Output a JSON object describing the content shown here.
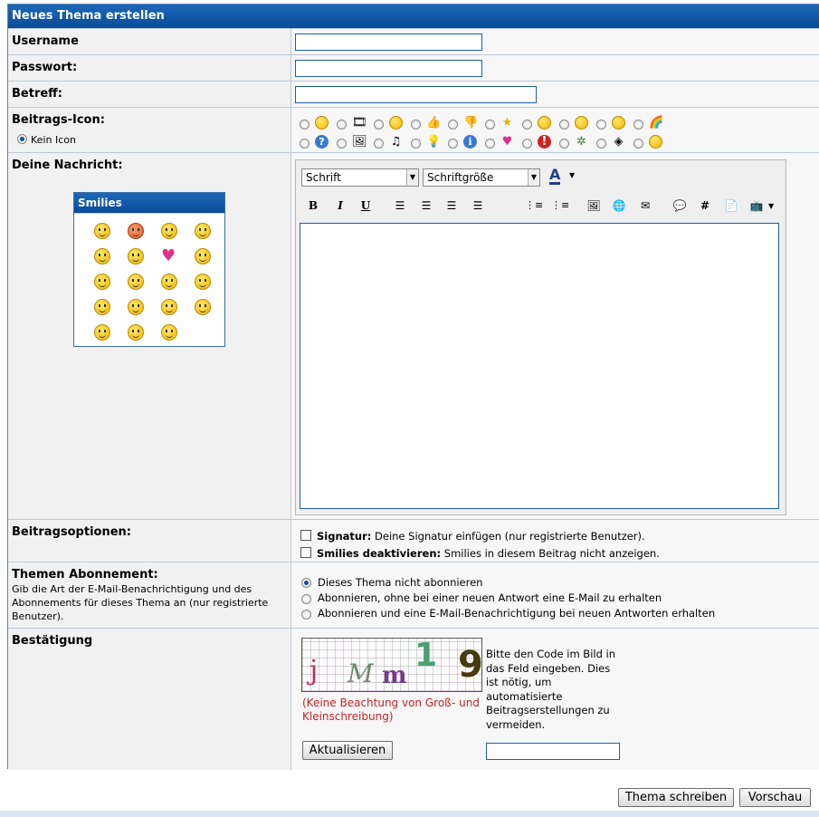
{
  "form": {
    "title": "Neues Thema erstellen",
    "username_label": "Username",
    "password_label": "Passwort:",
    "subject_label": "Betreff:",
    "icon_label": "Beitrags-Icon:",
    "no_icon_label": "Kein Icon",
    "message_label": "Deine Nachricht:",
    "smilies_title": "Smilies",
    "options_label": "Beitragsoptionen:",
    "signature_bold": "Signatur:",
    "signature_text": "Deine Signatur einfügen (nur registrierte Benutzer).",
    "smilies_off_bold": "Smilies deaktivieren:",
    "smilies_off_text": "Smilies in diesem Beitrag nicht anzeigen.",
    "subscription_label": "Themen Abonnement:",
    "subscription_desc": "Gib die Art der E-Mail-Benachrichtigung und des Abonnements für dieses Thema an (nur registrierte Benutzer).",
    "sub_opt1": "Dieses Thema nicht abonnieren",
    "sub_opt2": "Abonnieren, ohne bei einer neuen Antwort eine E-Mail zu erhalten",
    "sub_opt3": "Abonnieren und eine E-Mail-Benachrichtigung bei neuen Antworten erhalten",
    "confirm_label": "Bestätigung",
    "captcha_note": "(Keine Beachtung von Groß- und Kleinschreibung)",
    "captcha_help": "Bitte den Code im Bild in das Feld eingeben. Dies ist nötig, um automatisierte Beitragserstellungen zu vermeiden.",
    "captcha_chars": [
      "j",
      "M",
      "m",
      "1",
      "9"
    ],
    "refresh_button": "Aktualisieren",
    "submit_button": "Thema schreiben",
    "preview_button": "Vorschau"
  },
  "editor": {
    "font_select": "Schrift",
    "size_select": "Schriftgröße",
    "bold": "B",
    "italic": "I",
    "underline": "U",
    "color_letter": "A"
  },
  "colors": {
    "header_blue": "#0a4c98",
    "border_blue": "#5a84b0",
    "note_red": "#cc2222"
  }
}
